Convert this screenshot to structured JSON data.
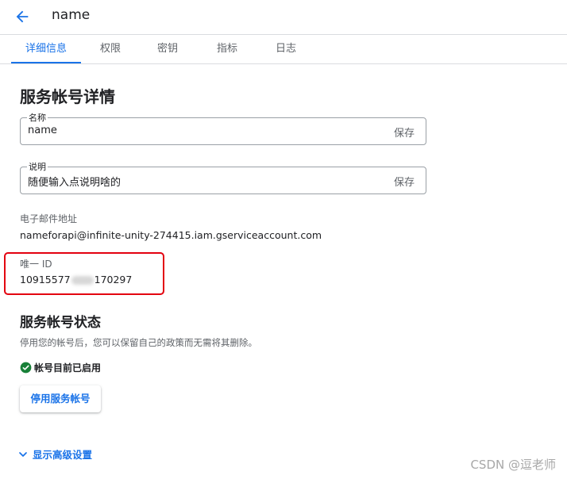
{
  "header": {
    "title": "name",
    "back_icon": "arrow-back-icon"
  },
  "tabs": [
    {
      "label": "详细信息",
      "active": true
    },
    {
      "label": "权限"
    },
    {
      "label": "密钥"
    },
    {
      "label": "指标"
    },
    {
      "label": "日志"
    }
  ],
  "details": {
    "heading": "服务帐号详情",
    "name_field": {
      "label": "名称",
      "value": "name",
      "save": "保存"
    },
    "desc_field": {
      "label": "说明",
      "value": "随便输入点说明啥的",
      "save": "保存"
    },
    "email_label": "电子邮件地址",
    "email_value": "nameforapi@infinite-unity-274415.iam.gserviceaccount.com",
    "uid_label": "唯一 ID",
    "uid_prefix": "10915577",
    "uid_suffix": "170297"
  },
  "status_section": {
    "heading": "服务帐号状态",
    "description": "停用您的帐号后，您可以保留自己的政策而无需将其删除。",
    "status_text": "帐号目前已启用",
    "status_icon": "check-circle-icon",
    "disable_button": "停用服务帐号"
  },
  "advanced_link": "显示高级设置",
  "watermark": "CSDN @逗老师",
  "colors": {
    "accent": "#1a73e8",
    "success": "#188038",
    "highlight": "#e3000f"
  }
}
